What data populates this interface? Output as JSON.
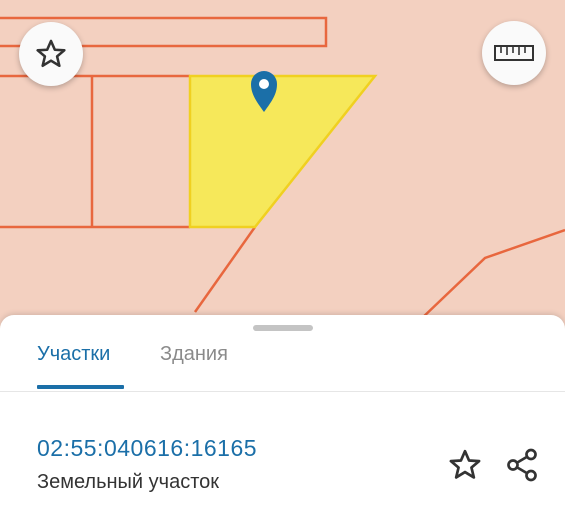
{
  "colors": {
    "map_background": "#f3d0c0",
    "boundary": "#e8673e",
    "selected_fill": "#f6e85a",
    "selected_stroke": "#f0d020",
    "pin": "#1b6fa8",
    "accent": "#1b6fa8"
  },
  "map": {
    "floating_buttons": [
      {
        "icon": "star-icon"
      },
      {
        "icon": "ruler-icon"
      }
    ],
    "marker_icon": "map-pin-icon"
  },
  "tabs": [
    {
      "label": "Участки",
      "active": true
    },
    {
      "label": "Здания",
      "active": false
    }
  ],
  "parcel": {
    "cadastral_number": "02:55:040616:16165",
    "type": "Земельный участок"
  },
  "actions": [
    {
      "icon": "star-outline-icon"
    },
    {
      "icon": "share-icon"
    }
  ]
}
